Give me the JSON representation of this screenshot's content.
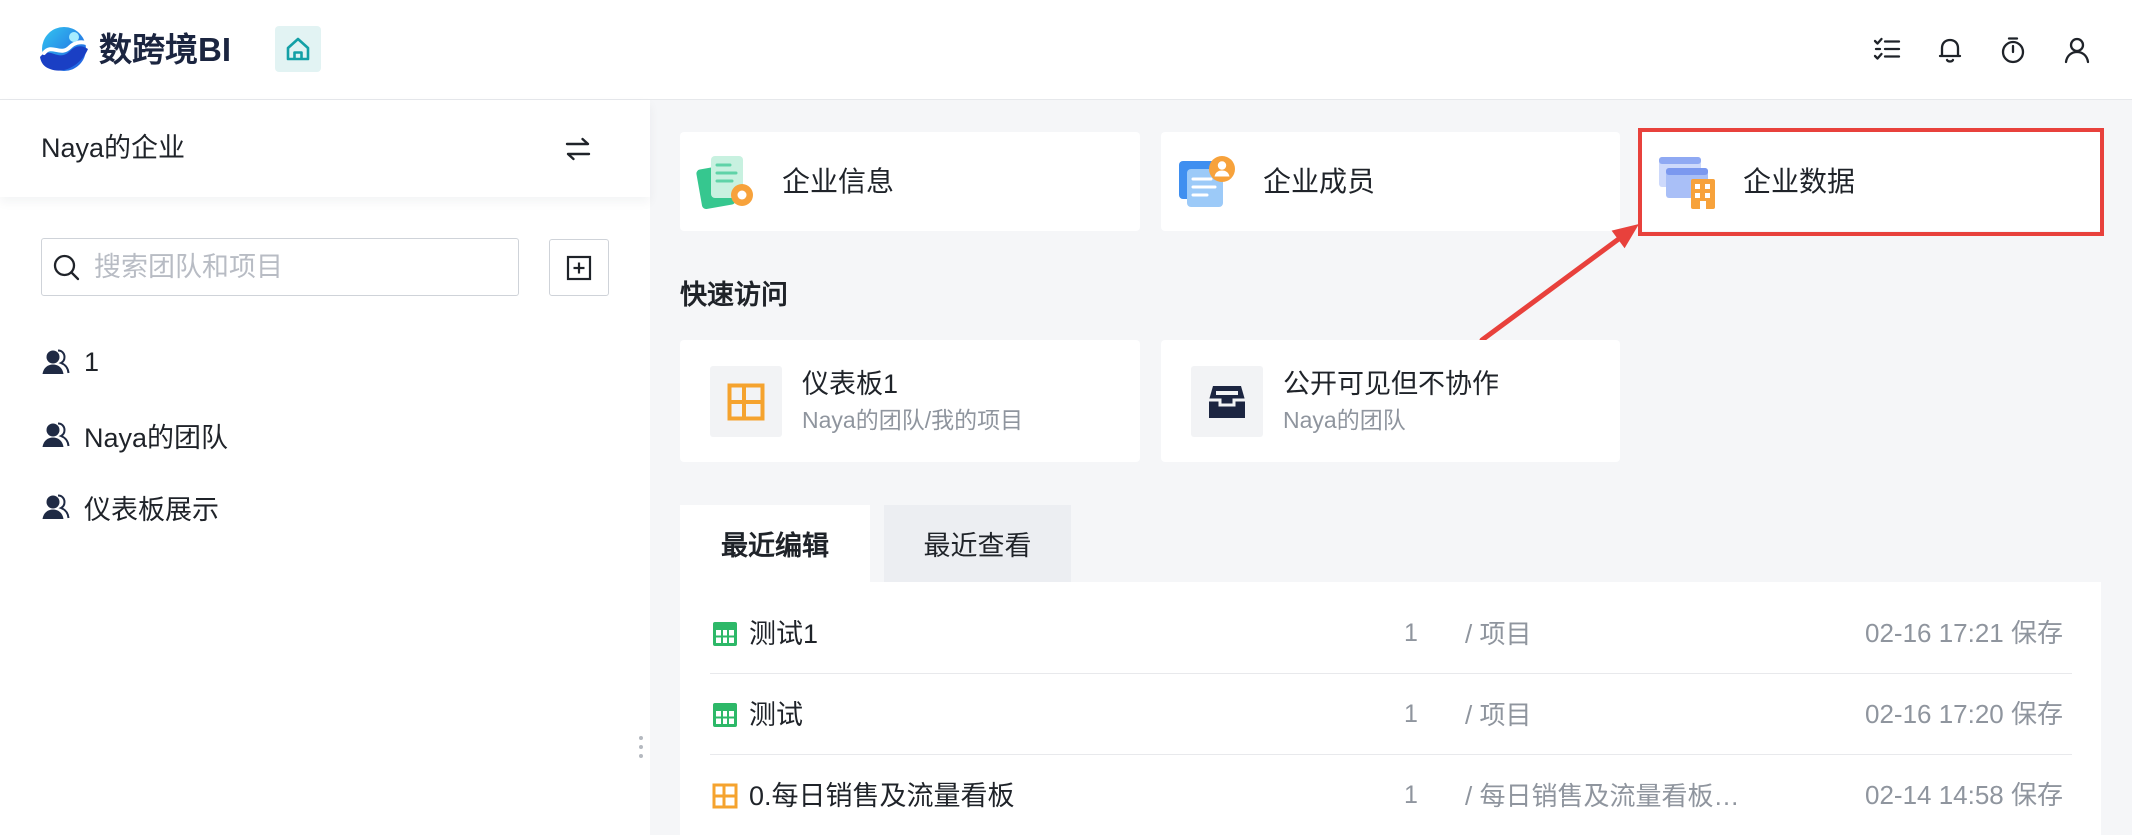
{
  "header": {
    "logo_text": "数跨境BI",
    "logo_icon": "brand-logo-icon",
    "home_icon": "home-icon",
    "actions": [
      {
        "icon": "task-list-icon"
      },
      {
        "icon": "bell-icon"
      },
      {
        "icon": "stopwatch-icon"
      },
      {
        "icon": "user-icon"
      }
    ]
  },
  "sidebar": {
    "org_name": "Naya的企业",
    "switch_icon": "switch-arrows-icon",
    "search_placeholder": "搜索团队和项目",
    "search_value": "",
    "add_icon": "add-square-icon",
    "teams": [
      {
        "label": "1",
        "icon": "team-icon"
      },
      {
        "label": "Naya的团队",
        "icon": "team-icon"
      },
      {
        "label": "仪表板展示",
        "icon": "team-icon"
      }
    ]
  },
  "main": {
    "enterprise_cards": [
      {
        "label": "企业信息",
        "icon": "enterprise-info-icon"
      },
      {
        "label": "企业成员",
        "icon": "enterprise-members-icon"
      },
      {
        "label": "企业数据",
        "icon": "enterprise-data-icon",
        "highlighted": true
      }
    ],
    "quick_access": {
      "title": "快速访问",
      "items": [
        {
          "title": "仪表板1",
          "subtitle": "Naya的团队/我的项目",
          "icon": "dashboard-icon"
        },
        {
          "title": "公开可见但不协作",
          "subtitle": "Naya的团队",
          "icon": "inbox-icon"
        }
      ]
    },
    "tabs": [
      {
        "label": "最近编辑",
        "active": true
      },
      {
        "label": "最近查看",
        "active": false
      }
    ],
    "recent": [
      {
        "name": "测试1",
        "count": "1",
        "path": "/ 项目",
        "time": "02-16 17:21 保存",
        "icon": "table-icon"
      },
      {
        "name": "测试",
        "count": "1",
        "path": "/ 项目",
        "time": "02-16 17:20 保存",
        "icon": "table-icon"
      },
      {
        "name": "0.每日销售及流量看板",
        "count": "1",
        "path": "/ 每日销售及流量看板…",
        "time": "02-14 14:58 保存",
        "icon": "dashboard-icon"
      }
    ]
  },
  "colors": {
    "accent_teal": "#14a0a6",
    "highlight_red": "#e8413c",
    "table_green": "#2db868",
    "dashboard_orange": "#f5a32e",
    "text_primary": "#1f2329",
    "text_secondary": "#8f959e",
    "page_bg": "#f5f6f8"
  }
}
